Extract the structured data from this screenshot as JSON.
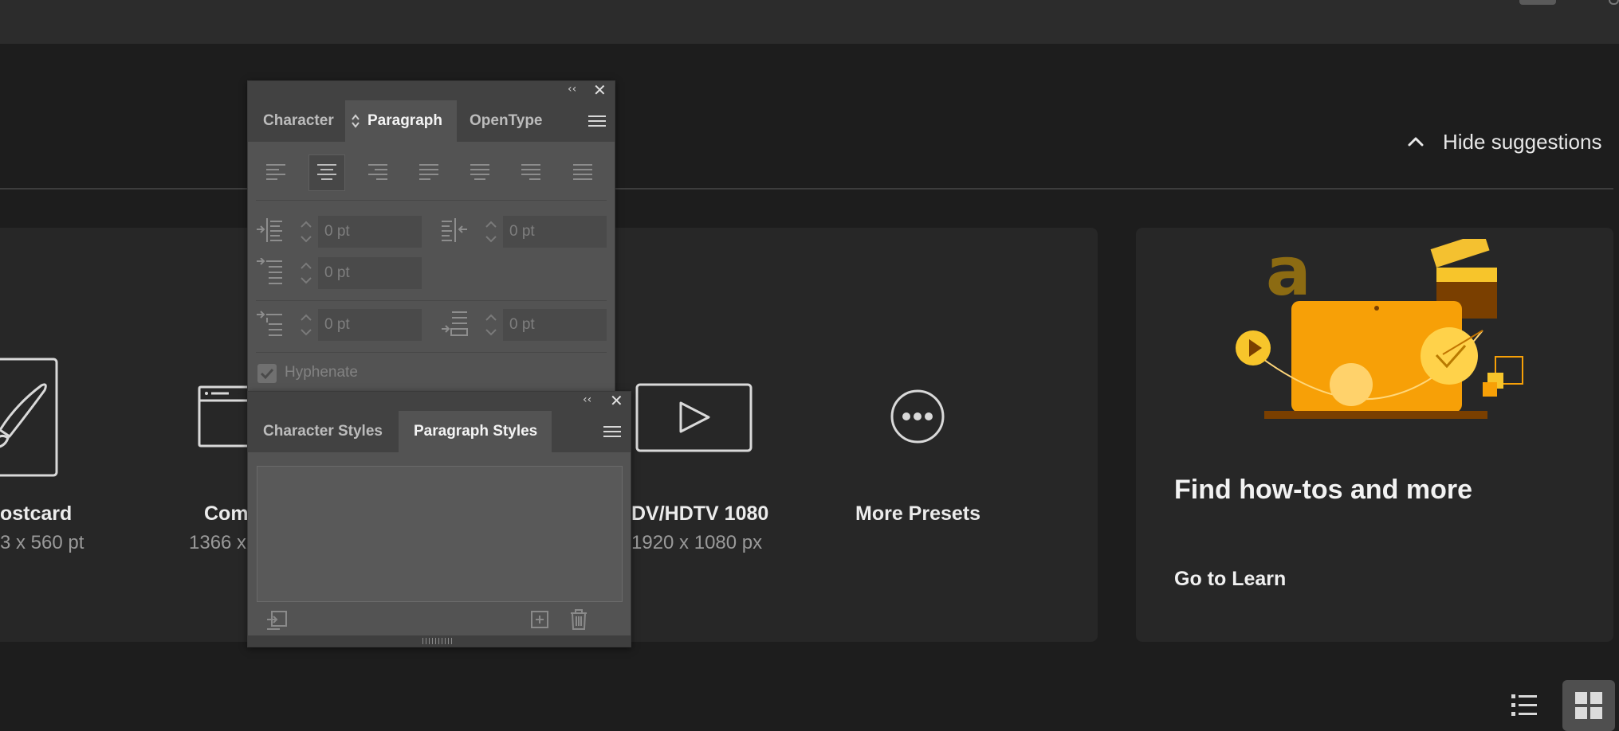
{
  "header": {
    "hide_suggestions_label": "Hide suggestions"
  },
  "presets": [
    {
      "name": "ostcard",
      "size": "3 x 560 pt",
      "icon": "paintbrush-icon"
    },
    {
      "name": "Com",
      "size": "1366 x",
      "icon": "browser-window-icon"
    },
    {
      "name": "DV/HDTV 1080",
      "size": "1920 x 1080 px",
      "icon": "play-icon"
    },
    {
      "name": "More Presets",
      "size": "",
      "icon": "ellipsis-icon"
    }
  ],
  "learn_card": {
    "title": "Find how-tos and more",
    "link": "Go to Learn"
  },
  "paragraph_panel": {
    "tabs": [
      "Character",
      "Paragraph",
      "OpenType"
    ],
    "active_tab": "Paragraph",
    "collapse_glyph": "‹‹",
    "close_glyph": "✕",
    "left_indent": "0 pt",
    "right_indent": "0 pt",
    "first_line_indent": "0 pt",
    "space_before": "0 pt",
    "space_after": "0 pt",
    "hyphenate_label": "Hyphenate",
    "hyphenate_checked": true
  },
  "styles_panel": {
    "tabs": [
      "Character Styles",
      "Paragraph Styles"
    ],
    "active_tab": "Paragraph Styles",
    "collapse_glyph": "‹‹",
    "close_glyph": "✕"
  },
  "colors": {
    "accent_orange": "#f7a007",
    "dark_orange": "#c27400",
    "background": "#1d1d1d",
    "card": "#272727",
    "panel": "#535353"
  }
}
